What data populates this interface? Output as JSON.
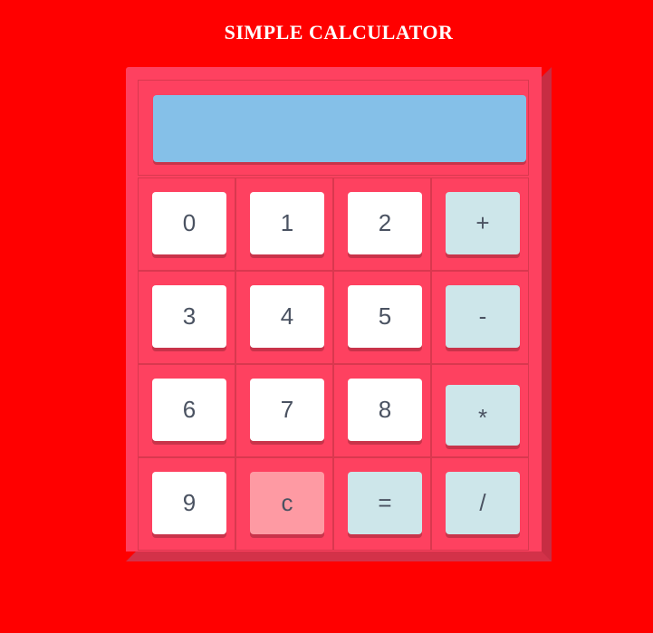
{
  "page": {
    "title": "SIMPLE CALCULATOR"
  },
  "display": {
    "value": ""
  },
  "keys": [
    {
      "label": "0",
      "kind": "digit"
    },
    {
      "label": "1",
      "kind": "digit"
    },
    {
      "label": "2",
      "kind": "digit"
    },
    {
      "label": "+",
      "kind": "operator"
    },
    {
      "label": "3",
      "kind": "digit"
    },
    {
      "label": "4",
      "kind": "digit"
    },
    {
      "label": "5",
      "kind": "digit"
    },
    {
      "label": "-",
      "kind": "operator"
    },
    {
      "label": "6",
      "kind": "digit"
    },
    {
      "label": "7",
      "kind": "digit"
    },
    {
      "label": "8",
      "kind": "digit"
    },
    {
      "label": "*",
      "kind": "operator"
    },
    {
      "label": "9",
      "kind": "digit"
    },
    {
      "label": "c",
      "kind": "clear"
    },
    {
      "label": "=",
      "kind": "operator"
    },
    {
      "label": "/",
      "kind": "operator"
    }
  ],
  "colors": {
    "background": "#ff0000",
    "calculator_body": "#fe4160",
    "display": "#85c0e8",
    "digit_key": "#ffffff",
    "operator_key": "#cde6ea",
    "clear_key": "#fe9aa3",
    "key_text": "#4a5261"
  }
}
